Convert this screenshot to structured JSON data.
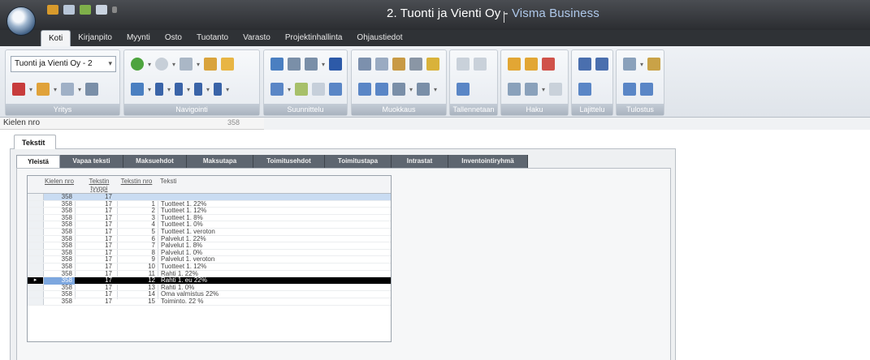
{
  "window": {
    "title_main": "2. Tuonti ja Vienti Oy - ",
    "title_brand": "Visma Business"
  },
  "menu_tabs": [
    "Koti",
    "Kirjanpito",
    "Myynti",
    "Osto",
    "Tuotanto",
    "Varasto",
    "Projektinhallinta",
    "Ohjaustiedot"
  ],
  "ribbon": {
    "company_combo": "Tuonti ja Vienti Oy - 2",
    "groups": [
      "Yritys",
      "Navigointi",
      "Suunnittelu",
      "Muokkaus",
      "Tallennetaan",
      "Haku",
      "Lajittelu",
      "Tulostus"
    ]
  },
  "field": {
    "label": "Kielen nro",
    "value": "358"
  },
  "outer_tab": "Tekstit",
  "sub_tabs": [
    "Yleistä",
    "Vapaa teksti",
    "Maksuehdot",
    "Maksutapa",
    "Toimitusehdot",
    "Toimitustapa",
    "Intrastat",
    "Inventointiryhmä"
  ],
  "grid": {
    "headers": {
      "c1": "Kielen nro",
      "c2": "Tekstin tyyppi",
      "c3": "Tekstin nro",
      "c4": "Teksti"
    },
    "new_row": {
      "c1": "358",
      "c2": "17",
      "c3": "",
      "c4": ""
    },
    "rows": [
      {
        "c1": "358",
        "c2": "17",
        "c3": "1",
        "c4": "Tuotteet 1. 22%"
      },
      {
        "c1": "358",
        "c2": "17",
        "c3": "2",
        "c4": "Tuotteet 1. 12%"
      },
      {
        "c1": "358",
        "c2": "17",
        "c3": "3",
        "c4": "Tuotteet 1. 8%"
      },
      {
        "c1": "358",
        "c2": "17",
        "c3": "4",
        "c4": "Tuotteet 1. 0%"
      },
      {
        "c1": "358",
        "c2": "17",
        "c3": "5",
        "c4": "Tuotteet 1. veroton"
      },
      {
        "c1": "358",
        "c2": "17",
        "c3": "6",
        "c4": "Palvelut 1. 22%"
      },
      {
        "c1": "358",
        "c2": "17",
        "c3": "7",
        "c4": "Palvelut 1. 8%"
      },
      {
        "c1": "358",
        "c2": "17",
        "c3": "8",
        "c4": "Palvelut 1. 0%"
      },
      {
        "c1": "358",
        "c2": "17",
        "c3": "9",
        "c4": "Palvelut 1. veroton"
      },
      {
        "c1": "358",
        "c2": "17",
        "c3": "10",
        "c4": "Tuotteet 1. 12%"
      },
      {
        "c1": "358",
        "c2": "17",
        "c3": "11",
        "c4": "Rahti 1. 22%"
      },
      {
        "c1": "358",
        "c2": "17",
        "c3": "12",
        "c4": "Rahti 1. eu 22%"
      },
      {
        "c1": "358",
        "c2": "17",
        "c3": "13",
        "c4": "Rahti 1. 0%"
      },
      {
        "c1": "358",
        "c2": "17",
        "c3": "14",
        "c4": "Oma valmistus 22%"
      },
      {
        "c1": "358",
        "c2": "17",
        "c3": "15",
        "c4": "Toiminto. 22 %"
      }
    ],
    "current_row_marker": "▸"
  },
  "colors": {
    "title_brand": "#aec8ea",
    "titlebar": "#2b2d31",
    "selected_row": "#000000",
    "new_row": "#c9dcf2"
  }
}
